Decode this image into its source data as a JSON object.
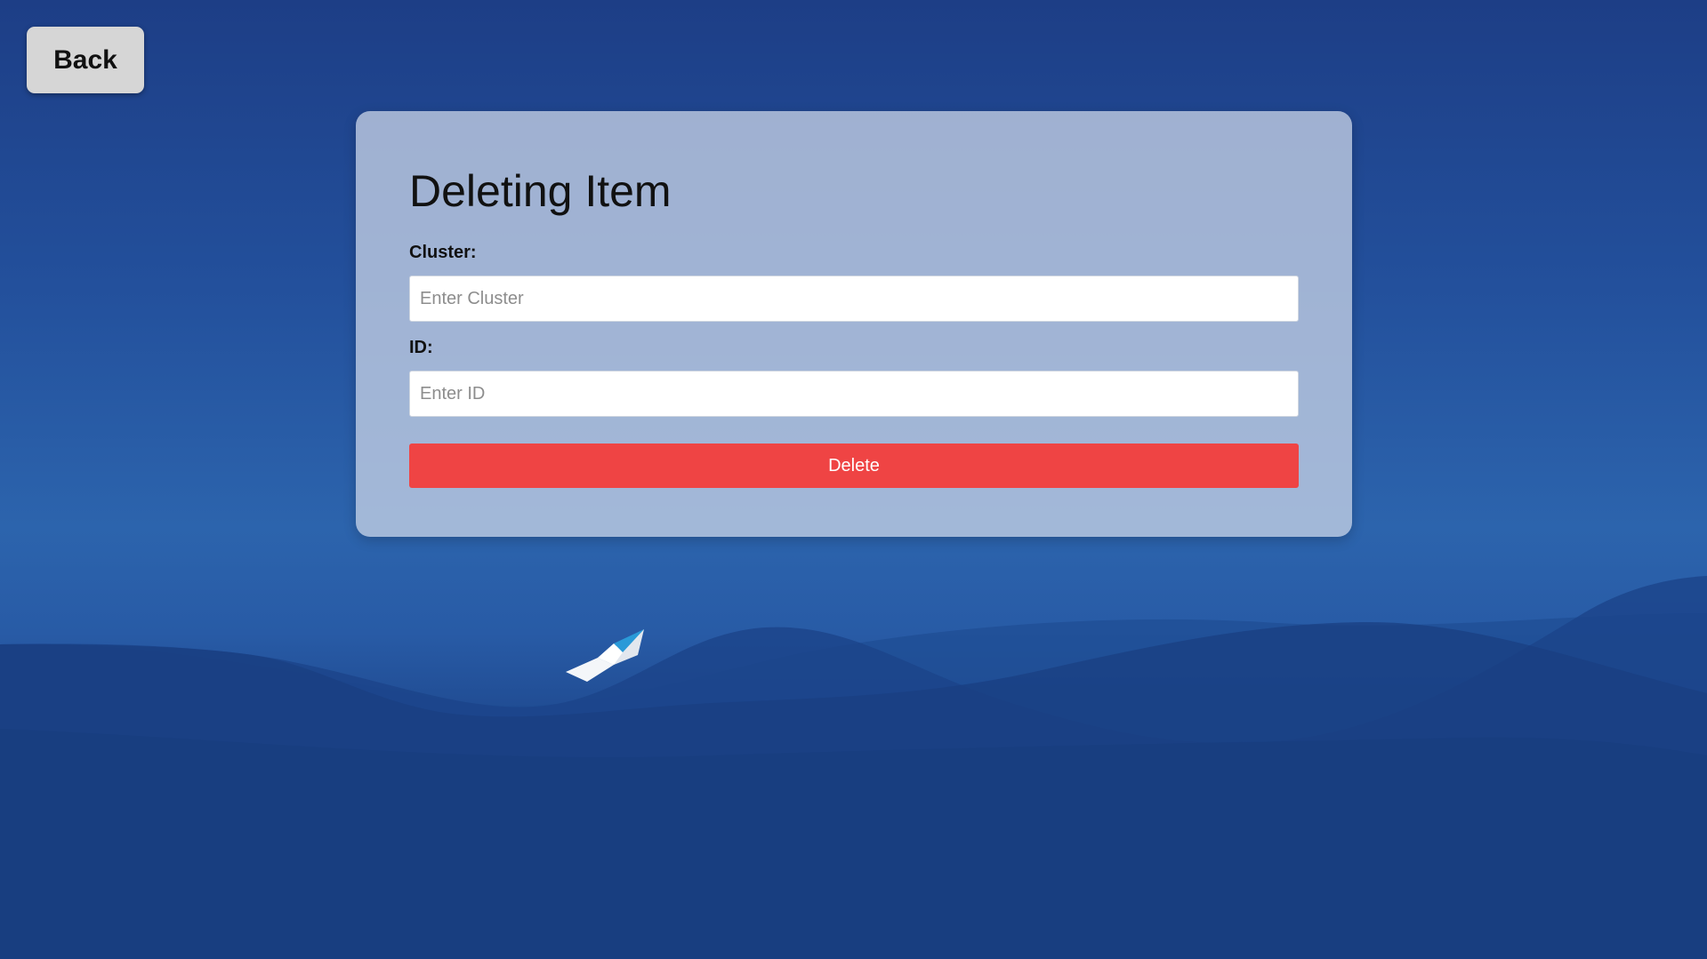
{
  "nav": {
    "back_label": "Back"
  },
  "form": {
    "title": "Deleting Item",
    "cluster": {
      "label": "Cluster:",
      "placeholder": "Enter Cluster",
      "value": ""
    },
    "id": {
      "label": "ID:",
      "placeholder": "Enter ID",
      "value": ""
    },
    "delete_label": "Delete"
  },
  "colors": {
    "background": "#23509c",
    "card": "#b2c1dc",
    "back_button": "#d6d6d6",
    "delete_button": "#ef4444"
  },
  "icons": {
    "background_decoration": "paper-boat-icon"
  }
}
